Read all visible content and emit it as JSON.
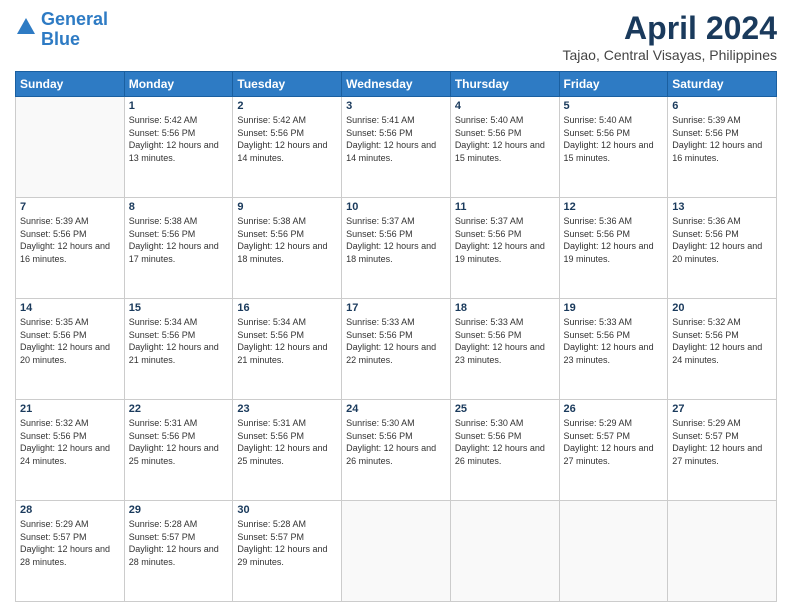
{
  "header": {
    "logo_line1": "General",
    "logo_line2": "Blue",
    "month_title": "April 2024",
    "location": "Tajao, Central Visayas, Philippines"
  },
  "days_of_week": [
    "Sunday",
    "Monday",
    "Tuesday",
    "Wednesday",
    "Thursday",
    "Friday",
    "Saturday"
  ],
  "weeks": [
    [
      {
        "day": "",
        "sunrise": "",
        "sunset": "",
        "daylight": ""
      },
      {
        "day": "1",
        "sunrise": "5:42 AM",
        "sunset": "5:56 PM",
        "daylight": "12 hours and 13 minutes."
      },
      {
        "day": "2",
        "sunrise": "5:42 AM",
        "sunset": "5:56 PM",
        "daylight": "12 hours and 14 minutes."
      },
      {
        "day": "3",
        "sunrise": "5:41 AM",
        "sunset": "5:56 PM",
        "daylight": "12 hours and 14 minutes."
      },
      {
        "day": "4",
        "sunrise": "5:40 AM",
        "sunset": "5:56 PM",
        "daylight": "12 hours and 15 minutes."
      },
      {
        "day": "5",
        "sunrise": "5:40 AM",
        "sunset": "5:56 PM",
        "daylight": "12 hours and 15 minutes."
      },
      {
        "day": "6",
        "sunrise": "5:39 AM",
        "sunset": "5:56 PM",
        "daylight": "12 hours and 16 minutes."
      }
    ],
    [
      {
        "day": "7",
        "sunrise": "5:39 AM",
        "sunset": "5:56 PM",
        "daylight": "12 hours and 16 minutes."
      },
      {
        "day": "8",
        "sunrise": "5:38 AM",
        "sunset": "5:56 PM",
        "daylight": "12 hours and 17 minutes."
      },
      {
        "day": "9",
        "sunrise": "5:38 AM",
        "sunset": "5:56 PM",
        "daylight": "12 hours and 18 minutes."
      },
      {
        "day": "10",
        "sunrise": "5:37 AM",
        "sunset": "5:56 PM",
        "daylight": "12 hours and 18 minutes."
      },
      {
        "day": "11",
        "sunrise": "5:37 AM",
        "sunset": "5:56 PM",
        "daylight": "12 hours and 19 minutes."
      },
      {
        "day": "12",
        "sunrise": "5:36 AM",
        "sunset": "5:56 PM",
        "daylight": "12 hours and 19 minutes."
      },
      {
        "day": "13",
        "sunrise": "5:36 AM",
        "sunset": "5:56 PM",
        "daylight": "12 hours and 20 minutes."
      }
    ],
    [
      {
        "day": "14",
        "sunrise": "5:35 AM",
        "sunset": "5:56 PM",
        "daylight": "12 hours and 20 minutes."
      },
      {
        "day": "15",
        "sunrise": "5:34 AM",
        "sunset": "5:56 PM",
        "daylight": "12 hours and 21 minutes."
      },
      {
        "day": "16",
        "sunrise": "5:34 AM",
        "sunset": "5:56 PM",
        "daylight": "12 hours and 21 minutes."
      },
      {
        "day": "17",
        "sunrise": "5:33 AM",
        "sunset": "5:56 PM",
        "daylight": "12 hours and 22 minutes."
      },
      {
        "day": "18",
        "sunrise": "5:33 AM",
        "sunset": "5:56 PM",
        "daylight": "12 hours and 23 minutes."
      },
      {
        "day": "19",
        "sunrise": "5:33 AM",
        "sunset": "5:56 PM",
        "daylight": "12 hours and 23 minutes."
      },
      {
        "day": "20",
        "sunrise": "5:32 AM",
        "sunset": "5:56 PM",
        "daylight": "12 hours and 24 minutes."
      }
    ],
    [
      {
        "day": "21",
        "sunrise": "5:32 AM",
        "sunset": "5:56 PM",
        "daylight": "12 hours and 24 minutes."
      },
      {
        "day": "22",
        "sunrise": "5:31 AM",
        "sunset": "5:56 PM",
        "daylight": "12 hours and 25 minutes."
      },
      {
        "day": "23",
        "sunrise": "5:31 AM",
        "sunset": "5:56 PM",
        "daylight": "12 hours and 25 minutes."
      },
      {
        "day": "24",
        "sunrise": "5:30 AM",
        "sunset": "5:56 PM",
        "daylight": "12 hours and 26 minutes."
      },
      {
        "day": "25",
        "sunrise": "5:30 AM",
        "sunset": "5:56 PM",
        "daylight": "12 hours and 26 minutes."
      },
      {
        "day": "26",
        "sunrise": "5:29 AM",
        "sunset": "5:57 PM",
        "daylight": "12 hours and 27 minutes."
      },
      {
        "day": "27",
        "sunrise": "5:29 AM",
        "sunset": "5:57 PM",
        "daylight": "12 hours and 27 minutes."
      }
    ],
    [
      {
        "day": "28",
        "sunrise": "5:29 AM",
        "sunset": "5:57 PM",
        "daylight": "12 hours and 28 minutes."
      },
      {
        "day": "29",
        "sunrise": "5:28 AM",
        "sunset": "5:57 PM",
        "daylight": "12 hours and 28 minutes."
      },
      {
        "day": "30",
        "sunrise": "5:28 AM",
        "sunset": "5:57 PM",
        "daylight": "12 hours and 29 minutes."
      },
      {
        "day": "",
        "sunrise": "",
        "sunset": "",
        "daylight": ""
      },
      {
        "day": "",
        "sunrise": "",
        "sunset": "",
        "daylight": ""
      },
      {
        "day": "",
        "sunrise": "",
        "sunset": "",
        "daylight": ""
      },
      {
        "day": "",
        "sunrise": "",
        "sunset": "",
        "daylight": ""
      }
    ]
  ]
}
